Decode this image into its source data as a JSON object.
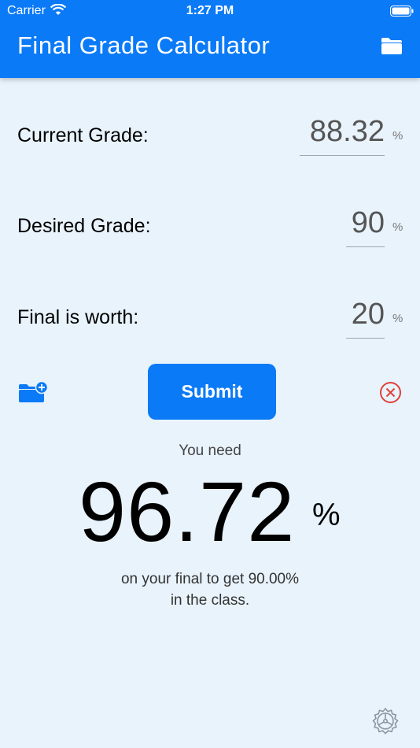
{
  "status_bar": {
    "carrier": "Carrier",
    "time": "1:27 PM"
  },
  "header": {
    "title": "Final Grade Calculator",
    "folder_icon": "folder-icon"
  },
  "inputs": {
    "current": {
      "label": "Current Grade:",
      "value": "88.32",
      "unit": "%"
    },
    "desired": {
      "label": "Desired Grade:",
      "value": "90",
      "unit": "%"
    },
    "final_worth": {
      "label": "Final is worth:",
      "value": "20",
      "unit": "%"
    }
  },
  "actions": {
    "submit_label": "Submit",
    "save_icon": "folder-add-icon",
    "clear_icon": "clear-circle-icon"
  },
  "result": {
    "prefix": "You need",
    "value": "96.72",
    "unit": "%",
    "line1": "on your final to get 90.00%",
    "line2": "in the class."
  },
  "colors": {
    "accent": "#0a7af7",
    "background": "#e9f3fc",
    "clear": "#e0403a",
    "settings": "#8b96a3"
  }
}
